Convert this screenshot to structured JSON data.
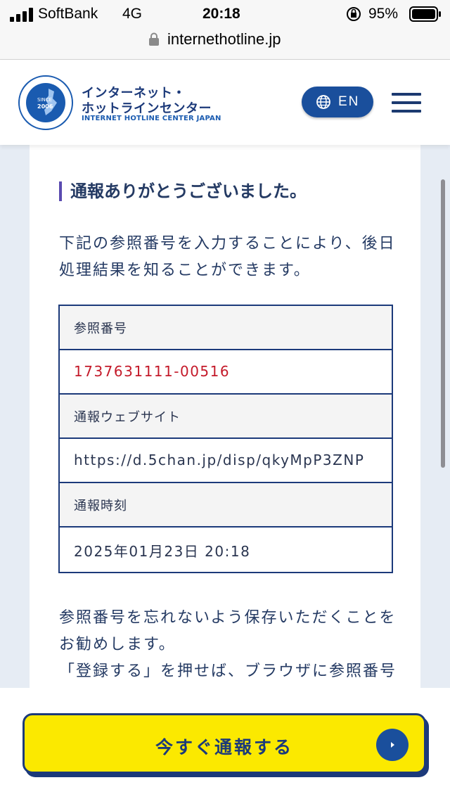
{
  "status_bar": {
    "carrier": "SoftBank",
    "network": "4G",
    "time": "20:18",
    "battery": "95%"
  },
  "browser": {
    "url": "internethotline.jp"
  },
  "header": {
    "logo_jp_line1": "インターネット・",
    "logo_jp_line2": "ホットラインセンター",
    "logo_en": "INTERNET HOTLINE CENTER JAPAN",
    "logo_seal_since": "SINCE",
    "logo_seal_year": "2006",
    "language_button": "EN"
  },
  "card": {
    "title": "通報ありがとうございました。",
    "intro": "下記の参照番号を入力することにより、後日処理結果を知ることができます。",
    "table": [
      {
        "kind": "head",
        "text": "参照番号"
      },
      {
        "kind": "value",
        "text": "1737631111-00516"
      },
      {
        "kind": "head",
        "text": "通報ウェブサイト"
      },
      {
        "kind": "value",
        "text": "https://d.5chan.jp/disp/qkyMpP3ZNP"
      },
      {
        "kind": "head",
        "text": "通報時刻"
      },
      {
        "kind": "value",
        "text": "2025年01月23日 20:18"
      }
    ],
    "note_line1": "参照番号を忘れないよう保存いただくことをお勧めします。",
    "note_line2": "「登録する」を押せば、ブラウザに参照番号"
  },
  "bottom_button": {
    "label": "今すぐ通報する"
  },
  "colors": {
    "brand_navy": "#1c3a7a",
    "accent_blue": "#1a4f9c",
    "cta_yellow": "#fbe900",
    "reference_red": "#c41a2a"
  }
}
